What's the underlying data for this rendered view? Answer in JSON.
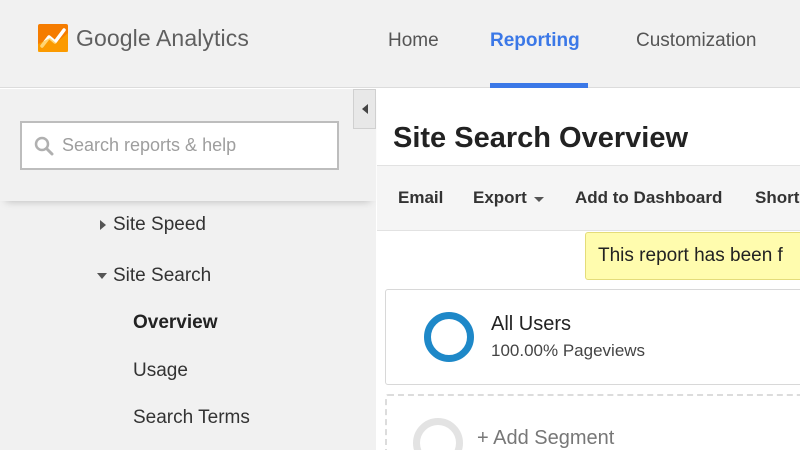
{
  "header": {
    "brand": "Google Analytics",
    "nav": [
      {
        "label": "Home"
      },
      {
        "label": "Reporting"
      },
      {
        "label": "Customization"
      }
    ],
    "active_tab": "Reporting",
    "accent_color": "#3b78e7",
    "logo_colors": [
      "#f57c00",
      "#ffb300"
    ]
  },
  "sidebar": {
    "search_placeholder": "Search reports & help",
    "items": [
      {
        "label": "Site Speed",
        "icon": "triangle-right-icon",
        "expanded": false
      },
      {
        "label": "Site Search",
        "icon": "triangle-down-icon",
        "expanded": true
      }
    ],
    "sub_items": [
      {
        "label": "Overview",
        "active": true
      },
      {
        "label": "Usage"
      },
      {
        "label": "Search Terms"
      }
    ]
  },
  "main": {
    "title": "Site Search Overview",
    "toolbar": [
      {
        "label": "Email"
      },
      {
        "label": "Export",
        "has_dropdown": true
      },
      {
        "label": "Add to Dashboard"
      },
      {
        "label": "Short"
      }
    ],
    "notice": "This report has been f",
    "segment": {
      "name": "All Users",
      "metric": "100.00% Pageviews",
      "color": "#1e88c8"
    },
    "add_segment": "+ Add Segment"
  }
}
